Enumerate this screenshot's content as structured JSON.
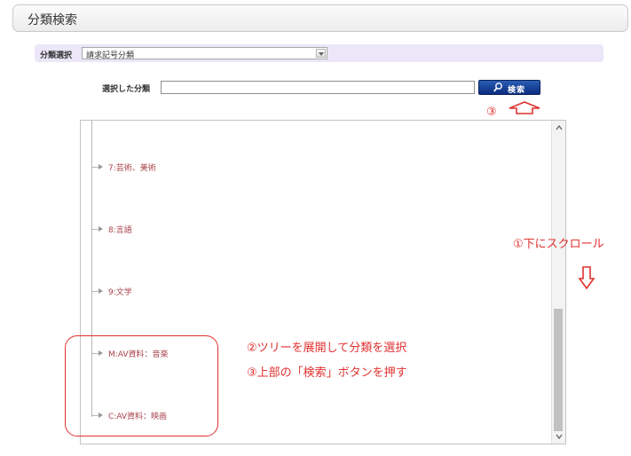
{
  "header": {
    "title": "分類検索"
  },
  "class_select": {
    "label": "分類選択",
    "value": "請求記号分類"
  },
  "selected_classification": {
    "label": "選択した分類",
    "value": ""
  },
  "search_button": {
    "label": "検索"
  },
  "tree": {
    "items": [
      {
        "label": "7:芸術、美術"
      },
      {
        "label": "8:言語"
      },
      {
        "label": "9:文学"
      },
      {
        "label": "M:AV資料：音楽"
      },
      {
        "label": "C:AV資料：映画"
      }
    ]
  },
  "annotations": {
    "step3_marker": "③",
    "step1": "①下にスクロール",
    "step2": "②ツリーを展開して分類を選択",
    "step3": "③上部の「検索」ボタンを押す"
  },
  "colors": {
    "annotation": "#e0312f",
    "tree_label": "#a8424a",
    "button": "#0b2c7e",
    "select_row_bg": "#ebe6f8"
  }
}
